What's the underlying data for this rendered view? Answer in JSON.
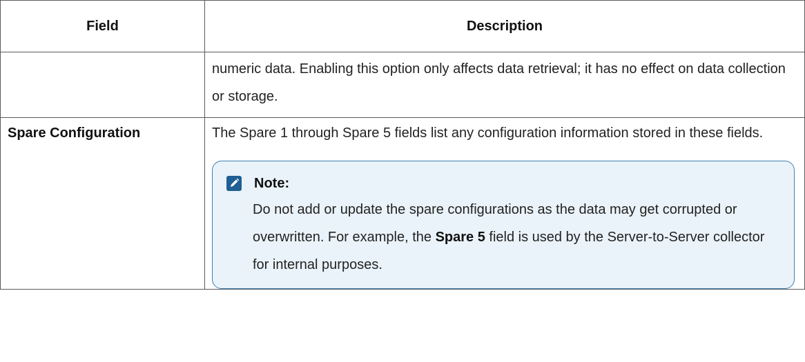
{
  "table": {
    "headers": {
      "field": "Field",
      "description": "Description"
    },
    "continuation_row": {
      "field": "",
      "description": "numeric data. Enabling this option only affects data retrieval; it has no effect on data collection or storage."
    },
    "spare_row": {
      "field": "Spare Configuration",
      "description": "The Spare 1 through Spare 5 fields list any configuration information stored in these fields.",
      "note": {
        "icon": "note-pencil-icon",
        "title": "Note:",
        "text_before": "Do not add or update the spare configurations as the data may get corrupted or overwritten. For example, the ",
        "bold": "Spare 5",
        "text_after": " field is used by the Server-to-Server collector for internal purposes."
      }
    }
  },
  "colors": {
    "note_border": "#3f7fb3",
    "note_background": "#eaf3f9",
    "note_icon": "#1f5f93",
    "table_border": "#5a5a5a"
  }
}
